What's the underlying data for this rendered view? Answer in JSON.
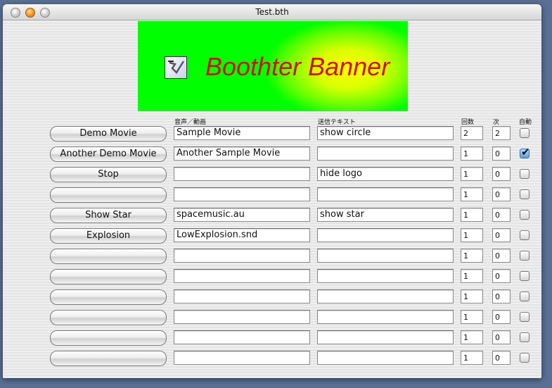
{
  "window": {
    "title": "Test.bth"
  },
  "banner": {
    "text": "Boothter Banner",
    "bg_colors": [
      "#00ff00",
      "#ffff00"
    ],
    "text_color": "#d21010"
  },
  "headers": {
    "sound": "音声／動画",
    "text": "送信テキスト",
    "count": "回数",
    "next": "次",
    "auto": "自動"
  },
  "rows": [
    {
      "button": "Demo Movie",
      "sound": "Sample Movie",
      "text": "show circle",
      "count": "2",
      "next": "2",
      "auto": false
    },
    {
      "button": "Another Demo Movie",
      "sound": "Another Sample Movie",
      "text": "",
      "count": "1",
      "next": "0",
      "auto": true
    },
    {
      "button": "Stop",
      "sound": "",
      "text": "hide logo",
      "count": "1",
      "next": "0",
      "auto": false
    },
    {
      "button": "",
      "sound": "",
      "text": "",
      "count": "1",
      "next": "0",
      "auto": false
    },
    {
      "button": "Show Star",
      "sound": "spacemusic.au",
      "text": "show star",
      "count": "1",
      "next": "0",
      "auto": false
    },
    {
      "button": "Explosion",
      "sound": "LowExplosion.snd",
      "text": "",
      "count": "1",
      "next": "0",
      "auto": false
    },
    {
      "button": "",
      "sound": "",
      "text": "",
      "count": "1",
      "next": "0",
      "auto": false
    },
    {
      "button": "",
      "sound": "",
      "text": "",
      "count": "1",
      "next": "0",
      "auto": false
    },
    {
      "button": "",
      "sound": "",
      "text": "",
      "count": "1",
      "next": "0",
      "auto": false
    },
    {
      "button": "",
      "sound": "",
      "text": "",
      "count": "1",
      "next": "0",
      "auto": false
    },
    {
      "button": "",
      "sound": "",
      "text": "",
      "count": "1",
      "next": "0",
      "auto": false
    },
    {
      "button": "",
      "sound": "",
      "text": "",
      "count": "1",
      "next": "0",
      "auto": false
    }
  ]
}
